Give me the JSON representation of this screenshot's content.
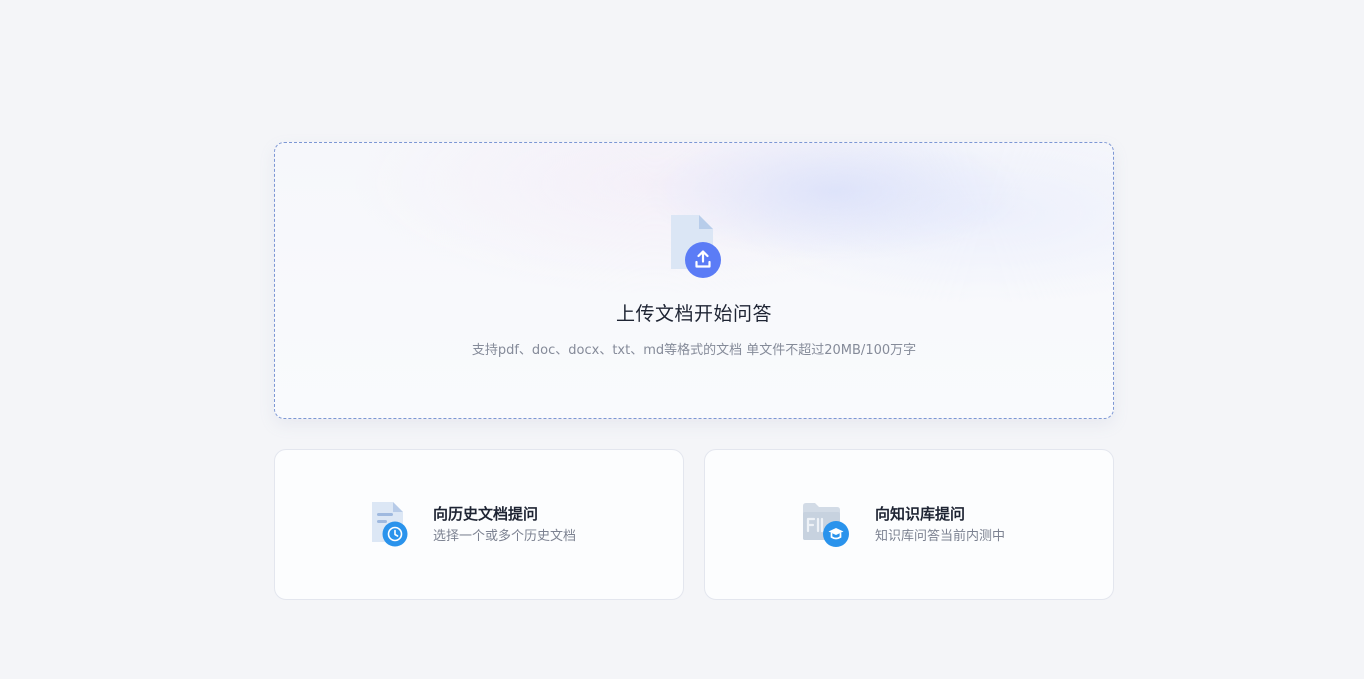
{
  "upload": {
    "icon": "file-upload-icon",
    "title": "上传文档开始问答",
    "subtitle": "支持pdf、doc、docx、txt、md等格式的文档 单文件不超过20MB/100万字"
  },
  "options": [
    {
      "icon": "history-document-icon",
      "title": "向历史文档提问",
      "description": "选择一个或多个历史文档"
    },
    {
      "icon": "knowledge-base-folder-icon",
      "title": "向知识库提问",
      "description": "知识库问答当前内测中"
    }
  ],
  "colors": {
    "accent": "#5b7cf6",
    "badge_blue": "#2a93ec",
    "background": "#f4f5f8"
  }
}
